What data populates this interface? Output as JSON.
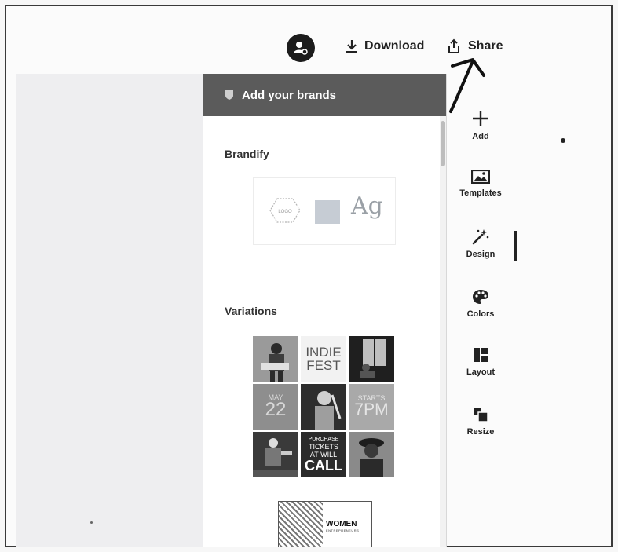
{
  "topbar": {
    "download_label": "Download",
    "share_label": "Share"
  },
  "panel": {
    "header_title": "Add your brands",
    "brandify_title": "Brandify",
    "logo_text": "LOGO",
    "font_sample": "Ag",
    "variations_title": "Variations",
    "variation_tiles": {
      "indie": "INDIE",
      "fest": "FEST",
      "may": "MAY",
      "day": "22",
      "starts": "STARTS",
      "time": "7PM",
      "purchase": "PURCHASE",
      "tickets": "TICKETS",
      "at_will": "AT WILL",
      "call": "CALL"
    },
    "thumb2_title": "WOMEN",
    "thumb2_sub": "ENTREPRENEURS"
  },
  "rail": {
    "items": [
      {
        "label": "Add",
        "icon": "plus-icon"
      },
      {
        "label": "Templates",
        "icon": "templates-icon"
      },
      {
        "label": "Design",
        "icon": "magic-wand-icon"
      },
      {
        "label": "Colors",
        "icon": "palette-icon"
      },
      {
        "label": "Layout",
        "icon": "layout-icon"
      },
      {
        "label": "Resize",
        "icon": "resize-icon"
      }
    ]
  }
}
